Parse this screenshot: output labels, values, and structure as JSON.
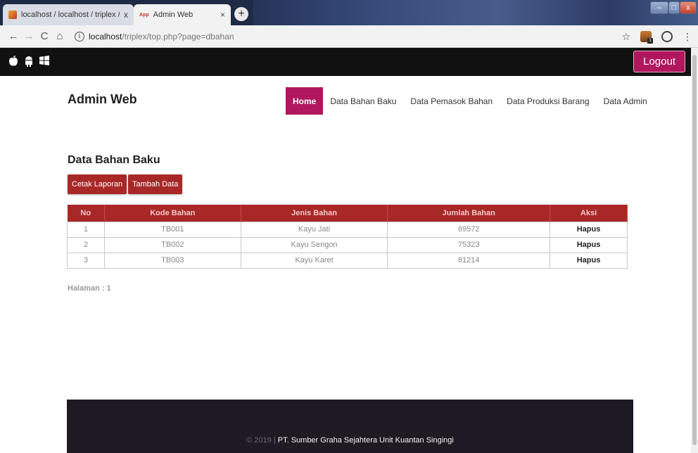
{
  "browser": {
    "tabs": [
      {
        "label": "localhost / localhost / triplex / p",
        "close": "x",
        "active": false
      },
      {
        "label": "Admin Web",
        "close": "×",
        "active": true
      }
    ],
    "new_tab": "+",
    "url_host": "localhost",
    "url_path": "/triplex/top.php?page=dbahan",
    "window_controls": {
      "minimize": "–",
      "maximize": "□",
      "close": "x"
    }
  },
  "topbar": {
    "os_icons": [
      "apple-icon",
      "android-icon",
      "windows-icon"
    ],
    "logout_label": "Logout"
  },
  "header": {
    "brand": "Admin Web",
    "nav": [
      {
        "label": "Home",
        "active": true
      },
      {
        "label": "Data Bahan Baku",
        "active": false
      },
      {
        "label": "Data Pemasok Bahan",
        "active": false
      },
      {
        "label": "Data Produksi Barang",
        "active": false
      },
      {
        "label": "Data Admin",
        "active": false
      }
    ]
  },
  "main": {
    "title": "Data Bahan Baku",
    "buttons": {
      "print_label": "Cetak Laporan",
      "add_label": "Tambah Data"
    },
    "table": {
      "columns": [
        "No",
        "Kode Bahan",
        "Jenis Bahan",
        "Jumlah Bahan",
        "Aksi"
      ],
      "rows": [
        [
          "1",
          "TB001",
          "Kayu Jati",
          "69572",
          "Hapus"
        ],
        [
          "2",
          "TB002",
          "Kayu Sengon",
          "75323",
          "Hapus"
        ],
        [
          "3",
          "TB003",
          "Kayu Karet",
          "81214",
          "Hapus"
        ]
      ]
    },
    "pagination": "Halaman : 1"
  },
  "footer": {
    "copyright": "© 2019 | ",
    "company": "PT. Sumber Graha Sejahtera Unit Kuantan Singingi"
  },
  "colors": {
    "accent": "#b0175e",
    "table_header": "#a82828",
    "topbar": "#111111",
    "footer": "#1d1a24"
  }
}
